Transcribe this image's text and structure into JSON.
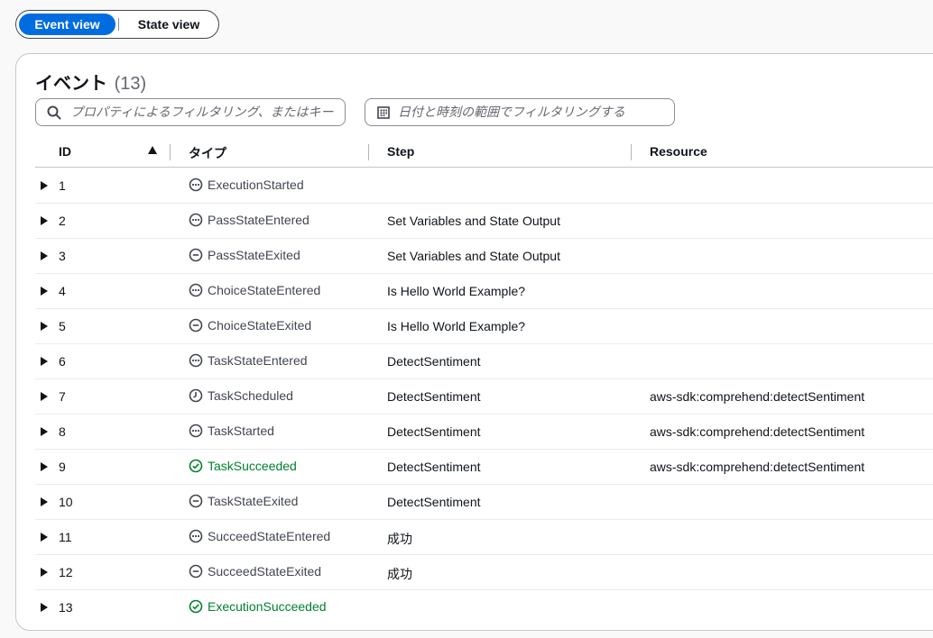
{
  "view_toggle": {
    "event_view": "Event view",
    "state_view": "State view"
  },
  "events_panel": {
    "title": "イベント",
    "count": "(13)",
    "search_placeholder": "プロパティによるフィルタリング、またはキー",
    "date_placeholder": "日付と時刻の範囲でフィルタリングする"
  },
  "table": {
    "columns": {
      "id": "ID",
      "type": "タイプ",
      "step": "Step",
      "resource": "Resource"
    },
    "sort_icon": "sort-ascending-icon",
    "rows": [
      {
        "id": "1",
        "type": "ExecutionStarted",
        "status": "in-progress",
        "step": "",
        "resource": ""
      },
      {
        "id": "2",
        "type": "PassStateEntered",
        "status": "in-progress",
        "step": "Set Variables and State Output",
        "resource": ""
      },
      {
        "id": "3",
        "type": "PassStateExited",
        "status": "stopped",
        "step": "Set Variables and State Output",
        "resource": ""
      },
      {
        "id": "4",
        "type": "ChoiceStateEntered",
        "status": "in-progress",
        "step": "Is Hello World Example?",
        "resource": ""
      },
      {
        "id": "5",
        "type": "ChoiceStateExited",
        "status": "stopped",
        "step": "Is Hello World Example?",
        "resource": ""
      },
      {
        "id": "6",
        "type": "TaskStateEntered",
        "status": "in-progress",
        "step": "DetectSentiment",
        "resource": ""
      },
      {
        "id": "7",
        "type": "TaskScheduled",
        "status": "pending",
        "step": "DetectSentiment",
        "resource": "aws-sdk:comprehend:detectSentiment"
      },
      {
        "id": "8",
        "type": "TaskStarted",
        "status": "in-progress",
        "step": "DetectSentiment",
        "resource": "aws-sdk:comprehend:detectSentiment"
      },
      {
        "id": "9",
        "type": "TaskSucceeded",
        "status": "success",
        "step": "DetectSentiment",
        "resource": "aws-sdk:comprehend:detectSentiment"
      },
      {
        "id": "10",
        "type": "TaskStateExited",
        "status": "stopped",
        "step": "DetectSentiment",
        "resource": ""
      },
      {
        "id": "11",
        "type": "SucceedStateEntered",
        "status": "in-progress",
        "step": "成功",
        "resource": ""
      },
      {
        "id": "12",
        "type": "SucceedStateExited",
        "status": "stopped",
        "step": "成功",
        "resource": ""
      },
      {
        "id": "13",
        "type": "ExecutionSucceeded",
        "status": "success",
        "step": "",
        "resource": ""
      }
    ]
  },
  "colors": {
    "accent": "#006ce0",
    "success": "#00802f",
    "text": "#0f141a",
    "muted": "#424650"
  }
}
